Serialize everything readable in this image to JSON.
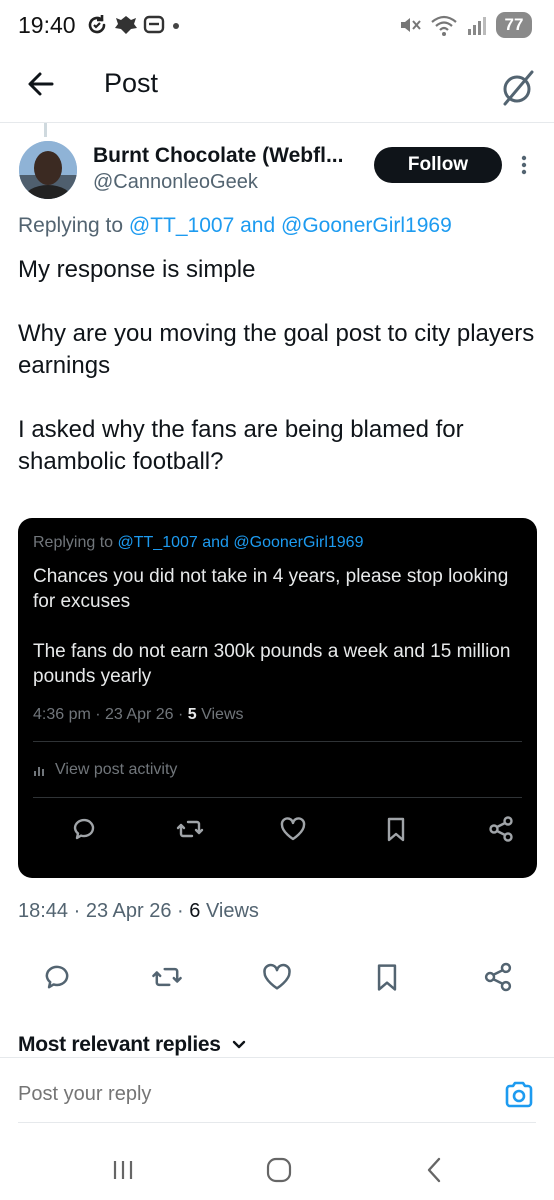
{
  "status_bar": {
    "time": "19:40",
    "battery": "77",
    "icons_left": [
      "sync-icon",
      "bank-app-icon",
      "message-icon",
      "dot-icon"
    ],
    "icons_right": [
      "mute-icon",
      "wifi-icon",
      "signal-icon",
      "battery-icon"
    ]
  },
  "header": {
    "title": "Post",
    "back_icon": "arrow-left-icon",
    "grok_icon": "grok-icon"
  },
  "post": {
    "author_name": "Burnt Chocolate (Webfl...",
    "author_handle": "@CannonleoGeek",
    "follow_label": "Follow",
    "reply_prefix": "Replying to",
    "reply_user1": "@TT_1007",
    "reply_and": "and",
    "reply_user2": "@GoonerGirl1969",
    "body": [
      "My response is simple",
      "Why are you moving the goal post to city players earnings",
      "I asked why the fans are being blamed for shambolic football?"
    ],
    "time": "18:44",
    "date": "23 Apr 26",
    "views_count": "6",
    "views_label": "Views"
  },
  "quoted": {
    "reply_prefix": "Replying to",
    "reply_user1": "@TT_1007",
    "reply_and": "and",
    "reply_user2": "@GoonerGirl1969",
    "body": [
      "Chances you did not take in 4 years, please stop looking for excuses",
      "The fans do not earn 300k pounds a week and 15 million pounds yearly"
    ],
    "time": "4:36 pm",
    "date": "23 Apr 26",
    "views_count": "5",
    "views_label": "Views",
    "activity_label": "View post activity"
  },
  "actions": [
    "reply-icon",
    "repost-icon",
    "like-icon",
    "bookmark-icon",
    "share-icon"
  ],
  "replies": {
    "sort_label": "Most relevant replies",
    "reply_placeholder": "Post your reply"
  },
  "colors": {
    "accent": "#1d9bf0",
    "text": "#0f1419",
    "secondary": "#536471",
    "quote_bg": "#000000"
  }
}
